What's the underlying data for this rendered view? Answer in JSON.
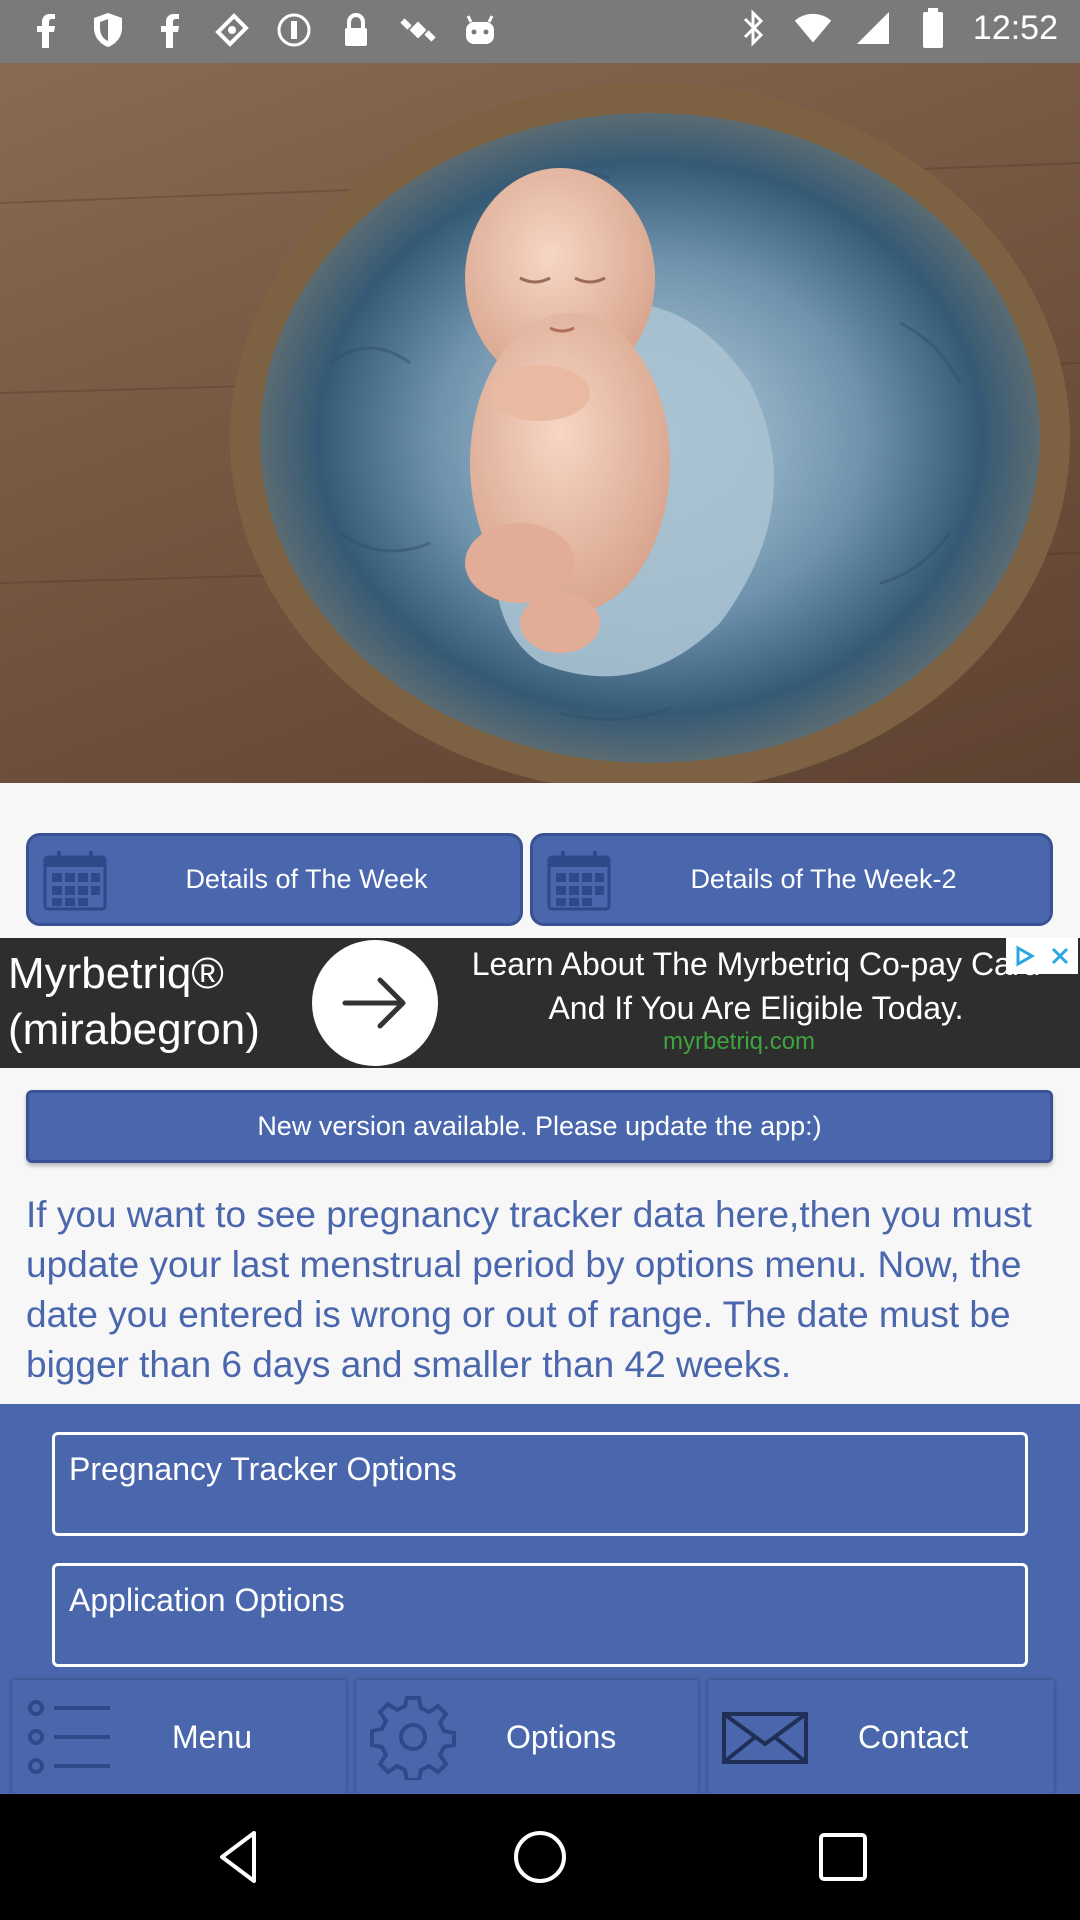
{
  "status_bar": {
    "time": "12:52",
    "left_icons": [
      "facebook-icon",
      "shield-icon",
      "facebook-icon",
      "puzzle-icon",
      "circle-info-icon",
      "lock-icon",
      "satellite-icon",
      "android-icon"
    ],
    "right_icons": [
      "bluetooth-icon",
      "wifi-icon",
      "signal-icon",
      "battery-icon"
    ]
  },
  "hero": {
    "caption": "-"
  },
  "week_buttons": {
    "week1_label": "Details of The Week",
    "week2_label": "Details of The Week-2"
  },
  "ad": {
    "brand": "Myrbetriq® (mirabegron)",
    "text": "Learn About The Myrbetriq Co-pay Card And If You Are Eligible Today.",
    "url": "myrbetriq.com"
  },
  "notice": {
    "text": "New version available. Please update the app:)"
  },
  "info": {
    "text": "If you want to see pregnancy tracker data here,then you must update your last menstrual period by options menu. Now, the date you entered is wrong or out of range. The date must be bigger than 6 days and smaller than 42 weeks."
  },
  "options": {
    "pregnancy_tracker": "Pregnancy Tracker Options",
    "application": "Application Options"
  },
  "tabs": {
    "menu": "Menu",
    "options": "Options",
    "contact": "Contact"
  },
  "colors": {
    "primary": "#4a67ad",
    "status_bar": "#7a7a7a",
    "ad_url": "#3fa340"
  }
}
